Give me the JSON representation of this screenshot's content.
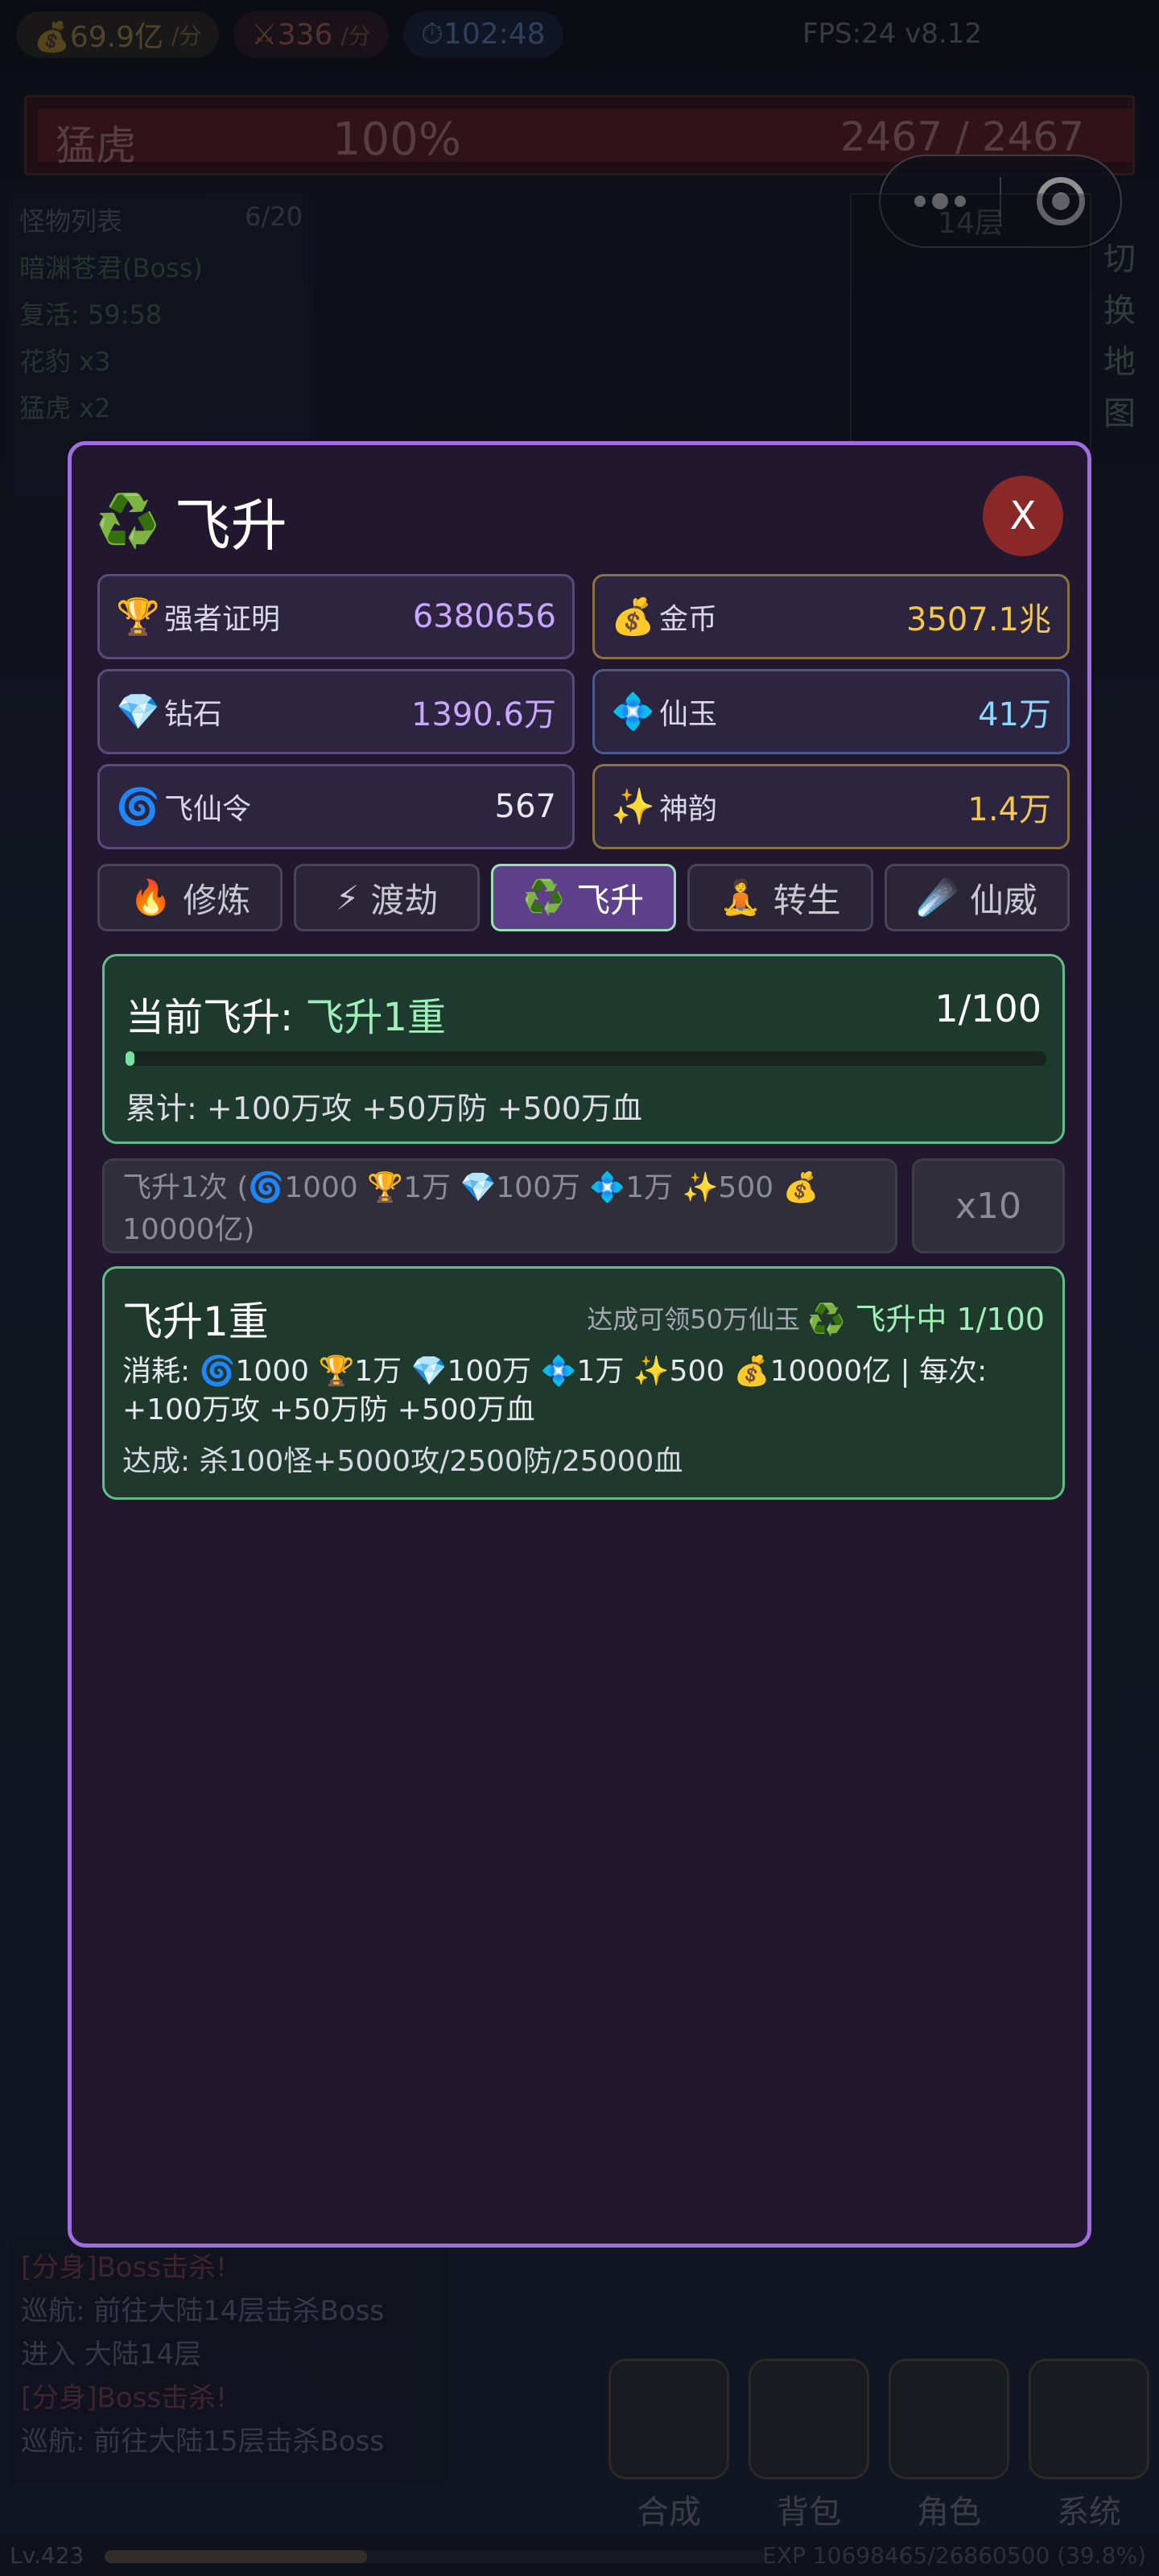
{
  "topbar": {
    "gold_rate": "💰69.9亿",
    "gold_unit": "/分",
    "kill_rate": "⚔336",
    "kill_unit": "/分",
    "timer": "⏱102:48",
    "fps": "FPS:24 v8.12"
  },
  "boss": {
    "name": "猛虎",
    "percent": "100%",
    "hp": "2467 / 2467",
    "hp_level": 1.0
  },
  "monster_list": {
    "title": "怪物列表",
    "count": "6/20",
    "rows": [
      "暗渊苍君(Boss)",
      "复活: 59:58",
      "花豹 x3",
      "猛虎 x2"
    ]
  },
  "minimap": {
    "floor": "14层",
    "switch_label": "切换地图"
  },
  "chat": {
    "lines": [
      {
        "text": "[分身]Boss击杀!",
        "type": "r"
      },
      {
        "text": "巡航: 前往大陆14层击杀Boss",
        "type": "n"
      },
      {
        "text": "进入 大陆14层",
        "type": "n"
      },
      {
        "text": "[分身]Boss击杀!",
        "type": "r"
      },
      {
        "text": "巡航: 前往大陆15层击杀Boss",
        "type": "n"
      }
    ]
  },
  "bottom_nav": [
    "合成",
    "背包",
    "角色",
    "系统"
  ],
  "exp": {
    "level": "Lv.423",
    "text": "EXP 10698465/26860500 (39.8%)",
    "fraction": 0.398
  },
  "modal": {
    "icon": "♻️",
    "title": "飞升",
    "close_label": "X",
    "stats": [
      {
        "icon": "🏆",
        "label": "强者证明",
        "value": "6380656",
        "color": "#c9a6ff",
        "style": ""
      },
      {
        "icon": "💰",
        "label": "金币",
        "value": "3507.1兆",
        "color": "#f4c84a",
        "style": "gold"
      },
      {
        "icon": "💎",
        "label": "钻石",
        "value": "1390.6万",
        "color": "#c9a6ff",
        "style": ""
      },
      {
        "icon": "💠",
        "label": "仙玉",
        "value": "41万",
        "color": "#8ad8ff",
        "style": "cyan"
      },
      {
        "icon": "🌀",
        "label": "飞仙令",
        "value": "567",
        "color": "#e8e8f0",
        "style": ""
      },
      {
        "icon": "✨",
        "label": "神韵",
        "value": "1.4万",
        "color": "#f4c84a",
        "style": "gold"
      }
    ],
    "tabs": [
      {
        "icon": "🔥",
        "label": "修炼",
        "active": false
      },
      {
        "icon": "⚡",
        "label": "渡劫",
        "active": false
      },
      {
        "icon": "♻️",
        "label": "飞升",
        "active": true
      },
      {
        "icon": "🧘",
        "label": "转生",
        "active": false
      },
      {
        "icon": "☄️",
        "label": "仙威",
        "active": false
      }
    ],
    "current": {
      "label": "当前飞升: ",
      "value": "飞升1重",
      "progress_text": "1/100",
      "progress": 0.01,
      "accumulated": "累计: +100万攻 +50万防 +500万血"
    },
    "action": {
      "main_label": "飞升1次 (🌀1000 🏆1万 💎100万 💠1万 ✨500 💰10000亿)",
      "x10_label": "x10"
    },
    "level_card": {
      "name": "飞升1重",
      "hint": "达成可领50万仙玉",
      "status": "♻️ 飞升中 1/100",
      "cost": "消耗: 🌀1000 🏆1万 💎100万 💠1万 ✨500 💰10000亿 | 每次: +100万攻 +50万防 +500万血",
      "requirement": "达成: 杀100怪+5000攻/2500防/25000血"
    }
  }
}
